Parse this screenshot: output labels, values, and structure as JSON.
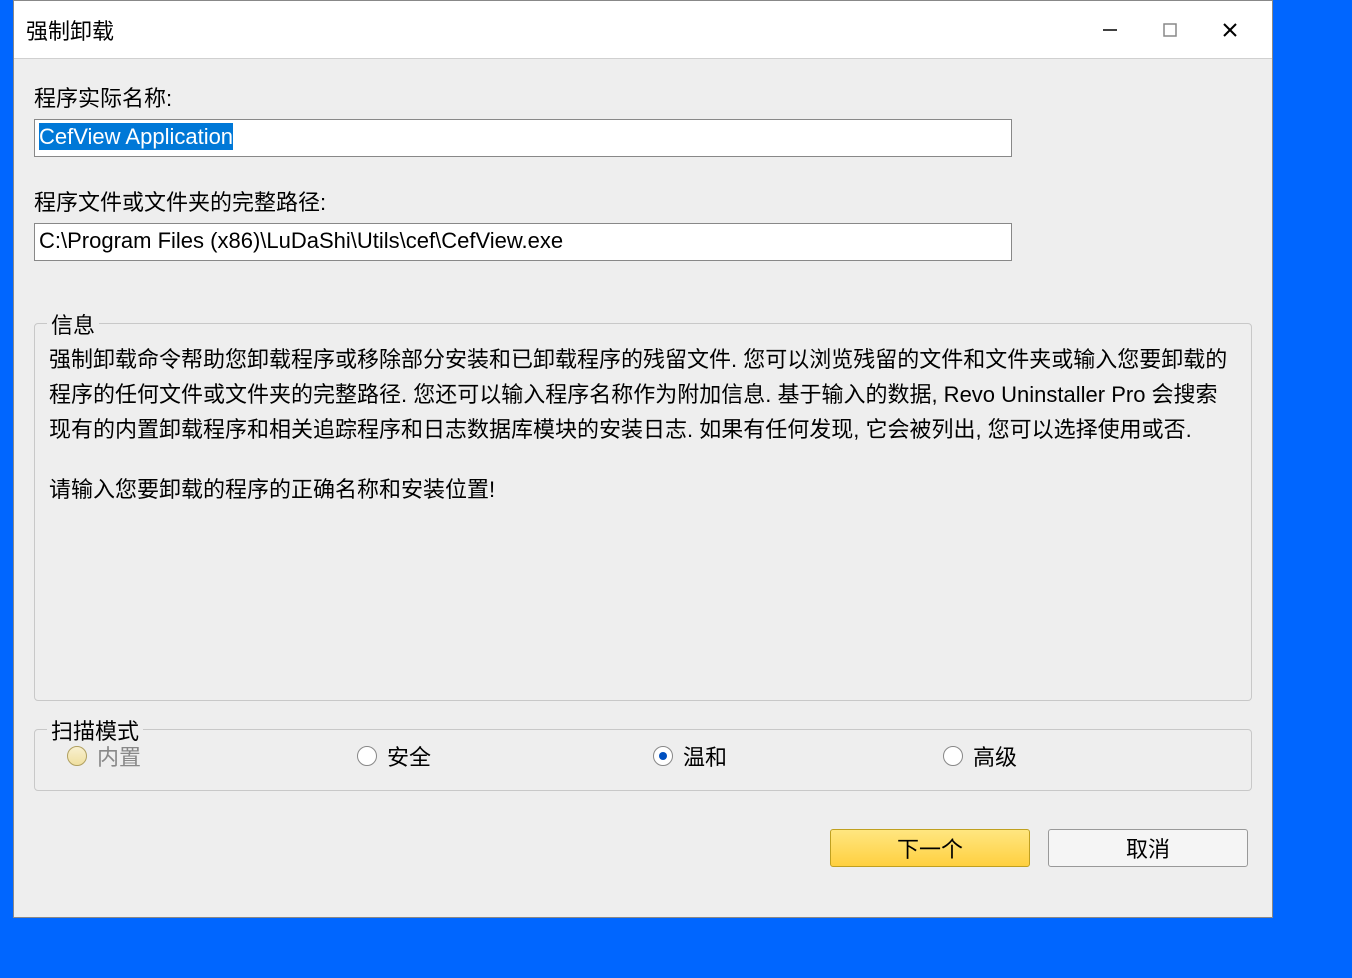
{
  "window": {
    "title": "强制卸载"
  },
  "fields": {
    "program_name_label": "程序实际名称:",
    "program_name_value": "CefView Application",
    "program_path_label": "程序文件或文件夹的完整路径:",
    "program_path_value": "C:\\Program Files (x86)\\LuDaShi\\Utils\\cef\\CefView.exe"
  },
  "info": {
    "legend": "信息",
    "paragraph1": "强制卸载命令帮助您卸载程序或移除部分安装和已卸载程序的残留文件. 您可以浏览残留的文件和文件夹或输入您要卸载的程序的任何文件或文件夹的完整路径. 您还可以输入程序名称作为附加信息. 基于输入的数据, Revo Uninstaller Pro 会搜索现有的内置卸载程序和相关追踪程序和日志数据库模块的安装日志. 如果有任何发现, 它会被列出, 您可以选择使用或否.",
    "paragraph2": "请输入您要卸载的程序的正确名称和安装位置!"
  },
  "scan": {
    "legend": "扫描模式",
    "options": [
      {
        "label": "内置",
        "selected": false,
        "disabled": true
      },
      {
        "label": "安全",
        "selected": false,
        "disabled": false
      },
      {
        "label": "温和",
        "selected": true,
        "disabled": false
      },
      {
        "label": "高级",
        "selected": false,
        "disabled": false
      }
    ]
  },
  "buttons": {
    "next": "下一个",
    "cancel": "取消"
  }
}
